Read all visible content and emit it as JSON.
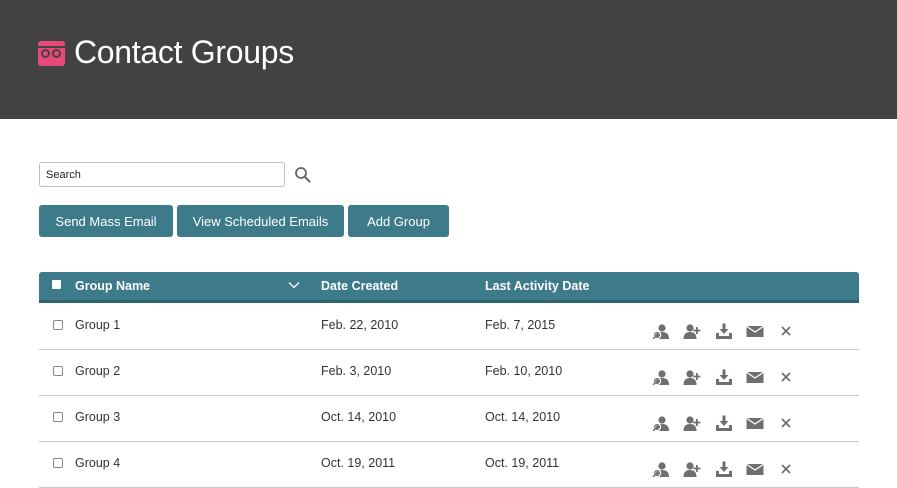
{
  "header": {
    "title": "Contact Groups"
  },
  "search": {
    "value": "Search"
  },
  "actions": {
    "send_mass_email": "Send Mass Email",
    "view_scheduled_emails": "View Scheduled Emails",
    "add_group": "Add Group"
  },
  "table": {
    "columns": {
      "name": "Group Name",
      "created": "Date Created",
      "activity": "Last Activity Date"
    },
    "rows": [
      {
        "name": "Group 1",
        "created": "Feb. 22, 2010",
        "activity": "Feb. 7, 2015"
      },
      {
        "name": "Group 2",
        "created": "Feb. 3, 2010",
        "activity": "Feb. 10, 2010"
      },
      {
        "name": "Group 3",
        "created": "Oct. 14, 2010",
        "activity": "Oct. 14, 2010"
      },
      {
        "name": "Group 4",
        "created": "Oct. 19, 2011",
        "activity": "Oct. 19, 2011"
      }
    ],
    "row_action_icons": [
      "view-contacts-icon",
      "add-contact-icon",
      "download-icon",
      "email-icon",
      "delete-icon"
    ]
  },
  "colors": {
    "header_bg": "#424242",
    "accent": "#3d7a8a",
    "logo": "#e8497a"
  }
}
